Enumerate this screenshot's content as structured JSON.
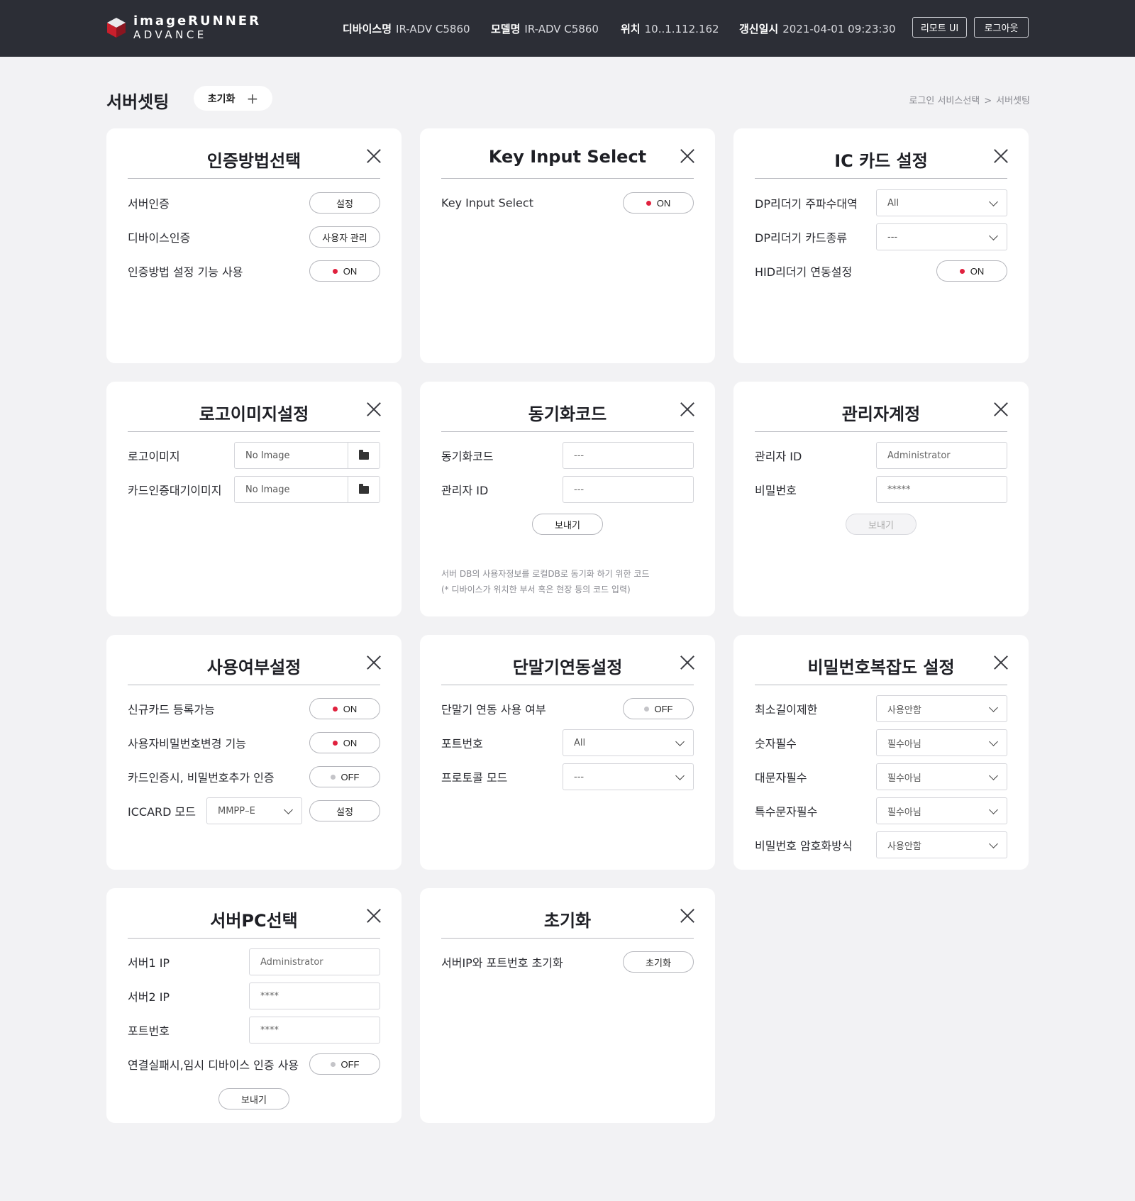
{
  "header": {
    "logo_line1": "imageRUNNER",
    "logo_line2": "ADVANCE",
    "device_name_label": "디바이스명",
    "device_name": "IR-ADV C5860",
    "model_label": "모델명",
    "model": "IR-ADV C5860",
    "location_label": "위치",
    "location": "10..1.112.162",
    "updated_label": "갱신일시",
    "updated": "2021-04-01 09:23:30",
    "remote_ui_label": "리모트 UI",
    "logout_label": "로그아웃"
  },
  "page": {
    "title": "서버셋팅",
    "reset_label": "초기화",
    "reset_plus": "+",
    "breadcrumb": [
      "로그인 서비스선택",
      "서버셋팅"
    ],
    "breadcrumb_sep": ">"
  },
  "cards": {
    "auth": {
      "title": "인증방법선택",
      "rows": [
        {
          "label": "서버인증",
          "button": "설정"
        },
        {
          "label": "디바이스인증",
          "button": "사용자 관리"
        },
        {
          "label": "인증방법 설정 기능 사용",
          "toggle": "ON"
        }
      ]
    },
    "key_input": {
      "title": "Key Input Select",
      "rows": [
        {
          "label": "Key Input Select",
          "toggle": "ON"
        }
      ]
    },
    "ic_card": {
      "title": "IC 카드 설정",
      "rows": [
        {
          "label": "DP리더기 주파수대역",
          "select": "All"
        },
        {
          "label": "DP리더기 카드종류",
          "select": "---"
        },
        {
          "label": "HID리더기 연동설정",
          "toggle": "ON"
        }
      ]
    },
    "logo_image": {
      "title": "로고이미지설정",
      "rows": [
        {
          "label": "로고이미지",
          "file": "No Image"
        },
        {
          "label": "카드인증대기이미지",
          "file": "No Image"
        }
      ]
    },
    "sync_code": {
      "title": "동기화코드",
      "rows": [
        {
          "label": "동기화코드",
          "input": "---"
        },
        {
          "label": "관리자 ID",
          "input": "---"
        }
      ],
      "send_label": "보내기",
      "note_line1": "서버 DB의 사용자정보를 로컬DB로 동기화 하기 위한 코드",
      "note_line2": "(* 디바이스가 위치한 부서 혹은 현장 등의 코드 입력)"
    },
    "admin_account": {
      "title": "관리자계정",
      "rows": [
        {
          "label": "관리자 ID",
          "input": "Administrator"
        },
        {
          "label": "비밀번호",
          "input": "*****"
        }
      ],
      "send_label": "보내기"
    },
    "usage": {
      "title": "사용여부설정",
      "rows": [
        {
          "label": "신규카드 등록가능",
          "toggle": "ON"
        },
        {
          "label": "사용자비밀번호변경 기능",
          "toggle": "ON"
        },
        {
          "label": "카드인증시, 비밀번호추가 인증",
          "toggle": "OFF"
        },
        {
          "label": "ICCARD 모드",
          "select": "MMPP–E",
          "button": "설정"
        }
      ]
    },
    "terminal": {
      "title": "단말기연동설정",
      "rows": [
        {
          "label": "단말기 연동 사용 여부",
          "toggle": "OFF"
        },
        {
          "label": "포트번호",
          "select": "All"
        },
        {
          "label": "프로토콜 모드",
          "select": "---"
        }
      ]
    },
    "password": {
      "title": "비밀번호복잡도 설정",
      "rows": [
        {
          "label": "최소길이제한",
          "select": "사용안함"
        },
        {
          "label": "숫자필수",
          "select": "필수아님"
        },
        {
          "label": "대문자필수",
          "select": "필수아님"
        },
        {
          "label": "특수문자필수",
          "select": "필수아님"
        },
        {
          "label": "비밀번호 암호화방식",
          "select": "사용안함"
        }
      ]
    },
    "server_pc": {
      "title": "서버PC선택",
      "rows": [
        {
          "label": "서버1 IP",
          "input": "Administrator"
        },
        {
          "label": "서버2 IP",
          "input": "****"
        },
        {
          "label": "포트번호",
          "input": "****"
        },
        {
          "label": "연결실패시,임시 디바이스 인증 사용",
          "toggle": "OFF"
        }
      ],
      "send_label": "보내기"
    },
    "reset": {
      "title": "초기화",
      "rows": [
        {
          "label": "서버IP와 포트번호 초기화",
          "button": "초기화"
        }
      ]
    }
  },
  "colors": {
    "header_bg": "#2c2e36",
    "toggle_on": "#e0213e",
    "toggle_off": "#c4c4c8",
    "page_bg": "#f2f2f4"
  }
}
